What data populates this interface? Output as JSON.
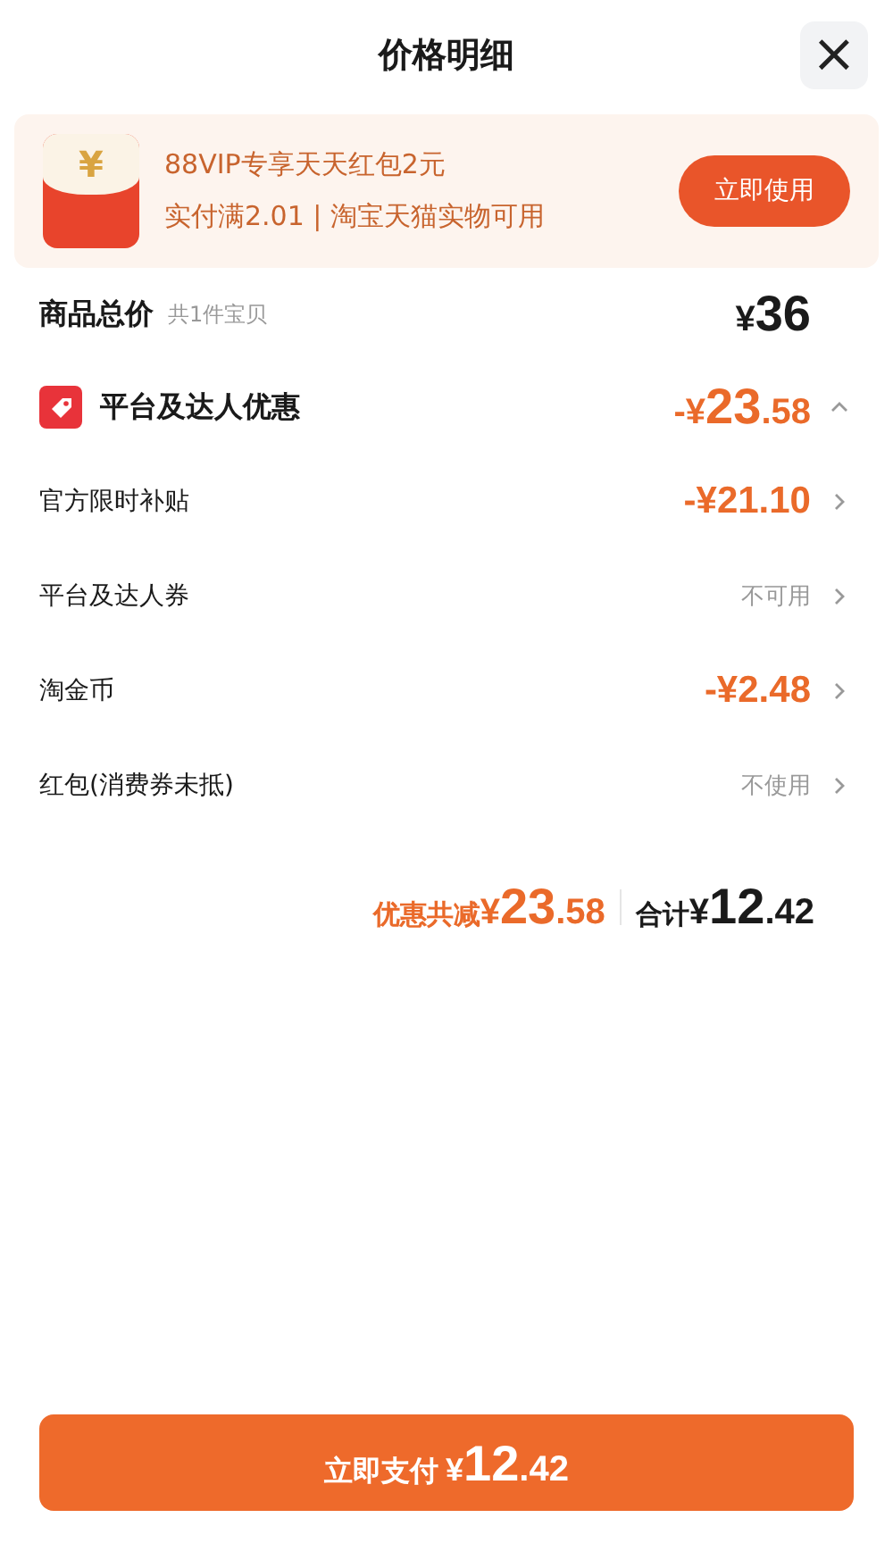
{
  "header": {
    "title": "价格明细",
    "close": "×"
  },
  "promo": {
    "coin": "¥",
    "title": "88VIP专享天天红包2元",
    "subtitle": "实付满2.01 | 淘宝天猫实物可用",
    "button": "立即使用"
  },
  "total": {
    "label": "商品总价",
    "note": "共1件宝贝",
    "price": {
      "currency": "¥",
      "integer": "36"
    }
  },
  "discount": {
    "label": "平台及达人优惠",
    "expanded": true,
    "price": {
      "currency": "-¥",
      "integer": "23",
      "decimal": ".58"
    },
    "items": [
      {
        "kind": "amount",
        "label": "官方限时补贴",
        "price": {
          "currency": "-¥",
          "integer": "21.10"
        }
      },
      {
        "kind": "status",
        "label": "平台及达人券",
        "status": "不可用"
      },
      {
        "kind": "amount",
        "label": "淘金币",
        "price": {
          "currency": "-¥",
          "integer": "2.48"
        }
      },
      {
        "kind": "status",
        "label": "红包(消费券未抵)",
        "status": "不使用"
      }
    ]
  },
  "summary": {
    "saved_label": "优惠共减",
    "saved": {
      "currency": "¥",
      "integer": "23",
      "decimal": ".58"
    },
    "total_label": "合计",
    "total": {
      "currency": "¥",
      "integer": "12",
      "decimal": ".42"
    }
  },
  "pay_button": {
    "label": "立即支付",
    "price": {
      "currency": "¥",
      "integer": "12",
      "decimal": ".42"
    }
  }
}
